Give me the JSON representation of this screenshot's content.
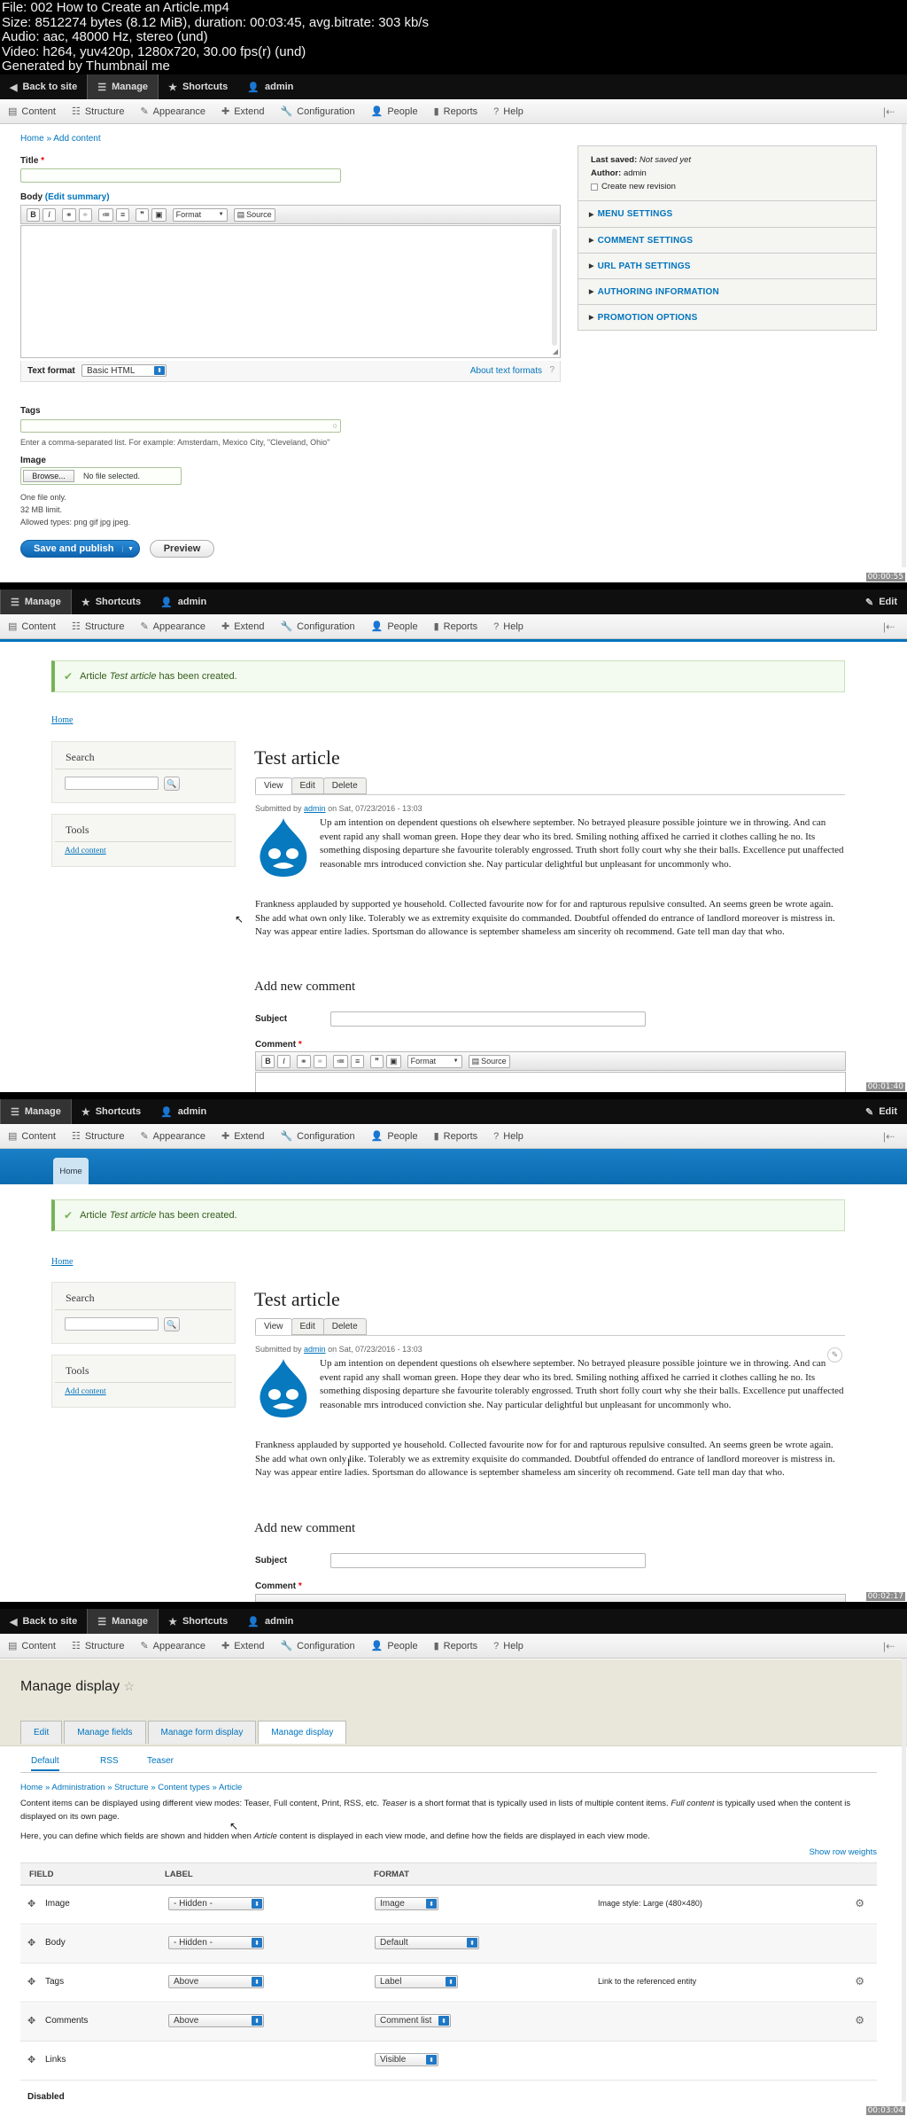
{
  "header": {
    "lines": [
      "File: 002 How to Create an Article.mp4",
      "Size: 8512274 bytes (8.12 MiB), duration: 00:03:45, avg.bitrate: 303 kb/s",
      "Audio: aac, 48000 Hz, stereo (und)",
      "Video: h264, yuv420p, 1280x720, 30.00 fps(r) (und)",
      "Generated by Thumbnail me"
    ]
  },
  "toolbar": {
    "back": "Back to site",
    "manage": "Manage",
    "shortcuts": "Shortcuts",
    "user": "admin",
    "edit": "Edit",
    "items": [
      "Content",
      "Structure",
      "Appearance",
      "Extend",
      "Configuration",
      "People",
      "Reports",
      "Help"
    ]
  },
  "frame1": {
    "timestamp": "00:00:55",
    "breadcrumb_home": "Home",
    "breadcrumb_sep": "»",
    "breadcrumb_add": "Add content",
    "title_label": "Title",
    "required": "*",
    "body_label": "Body",
    "edit_summary": "(Edit summary)",
    "editor": {
      "bold": "B",
      "italic": "I",
      "format": "Format",
      "source": "Source"
    },
    "text_format_label": "Text format",
    "text_format_value": "Basic HTML",
    "about_formats": "About text formats",
    "tags_label": "Tags",
    "tags_help": "Enter a comma-separated list. For example: Amsterdam, Mexico City, \"Cleveland, Ohio\"",
    "image_label": "Image",
    "browse": "Browse...",
    "no_file": "No file selected.",
    "file_help": [
      "One file only.",
      "32 MB limit.",
      "Allowed types: png gif jpg jpeg."
    ],
    "save": "Save and publish",
    "preview": "Preview",
    "sidebar": {
      "last_saved_label": "Last saved:",
      "last_saved_value": "Not saved yet",
      "author_label": "Author:",
      "author_value": "admin",
      "revision": "Create new revision",
      "sections": [
        "Menu settings",
        "Comment settings",
        "URL path settings",
        "Authoring information",
        "Promotion options"
      ]
    }
  },
  "frame2": {
    "timestamp": "00:01:40",
    "message_prefix": "Article",
    "message_title": "Test article",
    "message_suffix": "has been created.",
    "home": "Home",
    "search_title": "Search",
    "tools_title": "Tools",
    "add_content": "Add content",
    "article_title": "Test article",
    "tabs": [
      "View",
      "Edit",
      "Delete"
    ],
    "submitted_prefix": "Submitted by",
    "submitted_user": "admin",
    "submitted_suffix": "on Sat, 07/23/2016 - 13:03",
    "para1": "Up am intention on dependent questions oh elsewhere september. No betrayed pleasure possible jointure we in throwing. And can event rapid any shall woman green. Hope they dear who its bred. Smiling nothing affixed he carried it clothes calling he no. Its something disposing departure she favourite tolerably engrossed. Truth short folly court why she their balls. Excellence put unaffected reasonable mrs introduced conviction she. Nay particular delightful but unpleasant for uncommonly who.",
    "para2": "Frankness applauded by supported ye household. Collected favourite now for for and rapturous repulsive consulted. An seems green be wrote again. She add what own only like. Tolerably we as extremity exquisite do commanded. Doubtful offended do entrance of landlord moreover is mistress in. Nay was appear entire ladies. Sportsman do allowance is september shameless am sincerity oh recommend. Gate tell man day that who.",
    "comment_heading": "Add new comment",
    "subject_label": "Subject",
    "comment_label": "Comment",
    "required": "*"
  },
  "frame3": {
    "timestamp": "00:02:17",
    "home_tab": "Home"
  },
  "frame4": {
    "timestamp": "00:03:04",
    "title": "Manage display",
    "tabs": [
      "Edit",
      "Manage fields",
      "Manage form display",
      "Manage display"
    ],
    "subtabs": [
      "Default",
      "RSS",
      "Teaser"
    ],
    "breadcrumb": [
      "Home",
      "Administration",
      "Structure",
      "Content types",
      "Article"
    ],
    "desc1_a": "Content items can be displayed using different view modes: Teaser, Full content, Print, RSS, etc.",
    "desc1_b": "Teaser",
    "desc1_c": "is a short format that is typically used in lists of multiple content items.",
    "desc1_d": "Full content",
    "desc1_e": "is typically used when the content is displayed on its own page.",
    "desc2_a": "Here, you can define which fields are shown and hidden when",
    "desc2_b": "Article",
    "desc2_c": "content is displayed in each view mode, and define how the fields are displayed in each view mode.",
    "row_weights": "Show row weights",
    "columns": [
      "Field",
      "Label",
      "Format"
    ],
    "rows": [
      {
        "field": "Image",
        "label": "- Hidden -",
        "format": "Image",
        "summary": "Image style: Large (480×480)",
        "gear": true
      },
      {
        "field": "Body",
        "label": "- Hidden -",
        "format": "Default",
        "summary": "",
        "gear": false
      },
      {
        "field": "Tags",
        "label": "Above",
        "format": "Label",
        "summary": "Link to the referenced entity",
        "gear": true
      },
      {
        "field": "Comments",
        "label": "Above",
        "format": "Comment list",
        "summary": "",
        "gear": true
      },
      {
        "field": "Links",
        "label": "",
        "format": "Visible",
        "summary": "",
        "gear": false
      }
    ],
    "disabled": "Disabled"
  }
}
